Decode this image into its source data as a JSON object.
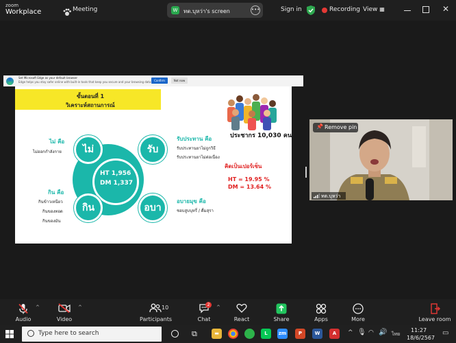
{
  "topbar": {
    "brand_line1": "zoom",
    "brand_line2": "Workplace",
    "meeting_label": "Meeting",
    "screen_badge": "W",
    "screen_label": "ทต.บุหว่า's screen",
    "more_icon": "ellipsis-icon",
    "signin_label": "Sign in",
    "recording_label": "Recording",
    "view_label": "View",
    "colors": {
      "recording": "#e53935",
      "shield": "#2ea84f"
    }
  },
  "edge_notice": {
    "title": "Set Microsoft Edge as your default browser",
    "body": "Edge helps you stay safer online with built-in tools that keep you secure and your browsing data private",
    "confirm_label": "Confirm",
    "notnow_label": "Not now"
  },
  "slide": {
    "step_label": "ขั้นตอนที่ 1",
    "analysis_label": "วิเคราะห์สถานการณ์",
    "center": {
      "ht": "HT 1,956",
      "dm": "DM 1,337"
    },
    "nodes": {
      "top_left": "ไม่",
      "top_right": "รับ",
      "bottom_left": "กิน",
      "bottom_right": "อบา"
    },
    "sections": {
      "mai": {
        "title": "ไม่ คือ",
        "items": [
          "ไม่ออกกำลังกาย"
        ]
      },
      "rap": {
        "title": "รับประทาน คือ",
        "items": [
          "รับประทานยาไม่ถูกวิธี",
          "รับประทานยาไม่ต่อเนื่อง"
        ]
      },
      "kin": {
        "title": "กิน คือ",
        "items": [
          "กินข้าวเหนียว",
          "กินของทอด",
          "กินของมัน"
        ]
      },
      "abayamuk": {
        "title": "อบายมุข คือ",
        "items": [
          "ชอบสูบบุหรี่ / ดื่มสุรา"
        ]
      }
    },
    "population": "ประชากร 10,030 คน",
    "percent_label": "คิดเป็นเปอร์เซ็น",
    "ht_pct": "HT = 19.95 %",
    "dm_pct": "DM = 13.64 %",
    "colors": {
      "teal": "#1bb7aa",
      "header": "#f7e727",
      "red": "#e02020"
    }
  },
  "video": {
    "remove_pin_label": "Remove pin",
    "name_label": "ทต.บุหว่า"
  },
  "toolbar": {
    "audio_label": "Audio",
    "video_label": "Video",
    "participants_label": "Participants",
    "participants_count": "10",
    "chat_label": "Chat",
    "chat_badge": "2",
    "react_label": "React",
    "share_label": "Share",
    "apps_label": "Apps",
    "more_label": "More",
    "leave_label": "Leave room",
    "colors": {
      "muted": "#e53935",
      "share": "#22c55e"
    }
  },
  "taskbar": {
    "search_placeholder": "Type here to search",
    "lang": "ไทย",
    "time": "11:27",
    "date": "18/6/2567"
  }
}
